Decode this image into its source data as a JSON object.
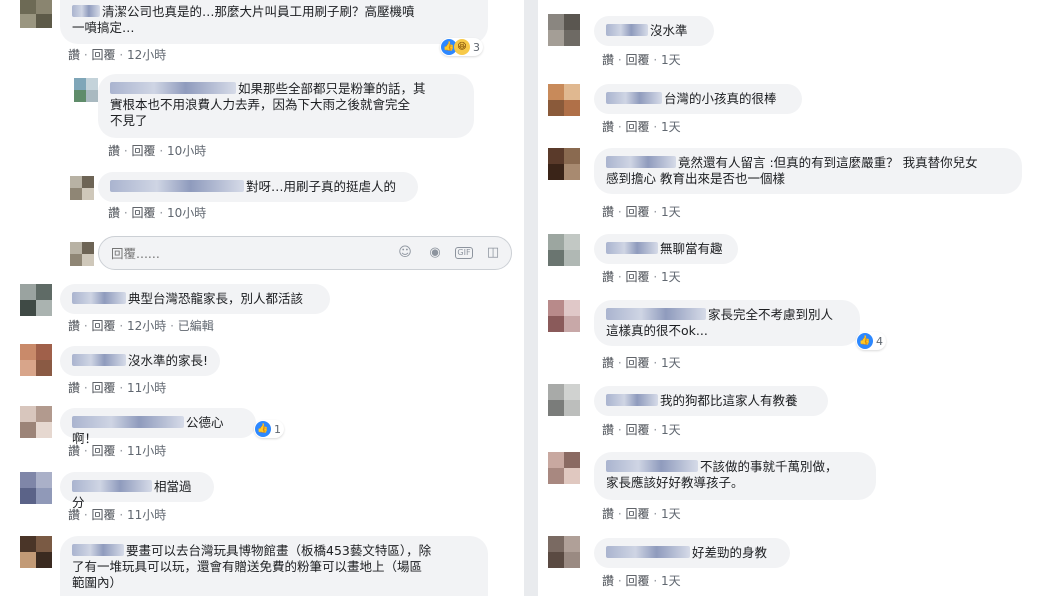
{
  "actions": {
    "like": "讚",
    "reply": "回覆",
    "dot": "·",
    "edited": "已編輯"
  },
  "reply_placeholder": "回覆......",
  "left": {
    "c1": {
      "text_line1": "清潔公司也真是的…那麼大片叫員工用刷子刷？高壓機噴",
      "text_line2": "一噴搞定…",
      "time": "12小時",
      "react_count": "3"
    },
    "r1": {
      "text_line1": "如果那些全部都只是粉筆的話，其",
      "text_line2": "實根本也不用浪費人力去弄，因為下大雨之後就會完全",
      "text_line3": "不見了",
      "time": "10小時"
    },
    "r2": {
      "text": "對呀…用刷子真的挺虐人的",
      "time": "10小時"
    },
    "c2": {
      "text": "典型台灣恐龍家長，別人都活該",
      "time": "12小時"
    },
    "c3": {
      "text": "沒水準的家長!",
      "time": "11小時"
    },
    "c4": {
      "text": "公德心啊！",
      "time": "11小時",
      "react_count": "1"
    },
    "c5": {
      "text": "相當過分",
      "time": "11小時"
    },
    "c6": {
      "text_line1": "要畫可以去台灣玩具博物館畫（板橋453藝文特區），除",
      "text_line2": "了有一堆玩具可以玩，還會有贈送免費的粉筆可以畫地上（場區",
      "text_line3": "範圍內）"
    }
  },
  "right": {
    "c1": {
      "text": "沒水準",
      "time": "1天"
    },
    "c2": {
      "text": "台灣的小孩真的很棒",
      "time": "1天"
    },
    "c3": {
      "text_line1": "竟然還有人留言 :但真的有到這麼嚴重？ 我真替你兒女",
      "text_line2": "感到擔心 教育出來是否也一個樣",
      "time": "1天"
    },
    "c4": {
      "text": "無聊當有趣",
      "time": "1天"
    },
    "c5": {
      "text_line1": "家長完全不考慮到別人",
      "text_line2": "這樣真的很不ok...",
      "time": "1天",
      "react_count": "4"
    },
    "c6": {
      "text": "我的狗都比這家人有教養",
      "time": "1天"
    },
    "c7": {
      "text_line1": "不該做的事就千萬別做，",
      "text_line2": "家長應該好好教導孩子。",
      "time": "1天"
    },
    "c8": {
      "text": "好差勁的身教",
      "time": "1天"
    }
  },
  "icons": {
    "like": "like-icon",
    "haha": "haha-icon",
    "emoji": "emoji-icon",
    "camera": "camera-icon",
    "gif": "gif-icon",
    "sticker": "sticker-icon"
  },
  "colors": {
    "bubble": "#f2f3f5",
    "link": "#4b4f56",
    "meta": "#606770",
    "like_blue": "#2d88ff",
    "page_bg": "#e9ebee"
  }
}
